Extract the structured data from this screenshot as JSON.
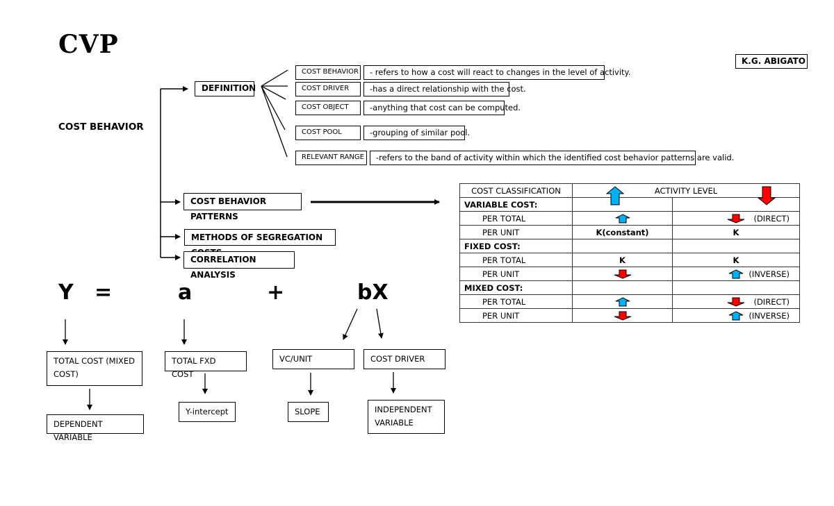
{
  "title": "CVP",
  "author": "K.G. ABIGATO",
  "root": "COST BEHAVIOR",
  "branches": {
    "definition": "DEFINITION",
    "patterns": "COST BEHAVIOR PATTERNS",
    "methods": "METHODS OF SEGREGATION COSTS",
    "correlation": "CORRELATION ANALYSIS"
  },
  "definitions": [
    {
      "term": "COST BEHAVIOR",
      "desc": "- refers to how a cost will react to changes in the level of activity."
    },
    {
      "term": "COST DRIVER",
      "desc": "-has a direct relationship with the cost."
    },
    {
      "term": "COST OBJECT",
      "desc": "-anything that cost can be computed."
    },
    {
      "term": "COST POOL",
      "desc": "-grouping of similar pool."
    },
    {
      "term": "RELEVANT RANGE",
      "desc": "-refers to the band of activity within which the identified cost behavior patterns are valid."
    }
  ],
  "equation": {
    "y": "Y",
    "eq": "=",
    "a": "a",
    "plus": "+",
    "bx": "bX"
  },
  "equation_labels": {
    "y_box": "TOTAL COST (MIXED COST)",
    "y_result": "DEPENDENT VARIABLE",
    "a_box": "TOTAL FXD COST",
    "a_result": "Y-intercept",
    "b_box": "VC/UNIT",
    "b_result": "SLOPE",
    "x_box": "COST DRIVER",
    "x_result": "INDEPENDENT VARIABLE"
  },
  "table": {
    "header": {
      "col1": "COST CLASSIFICATION",
      "col2": "ACTIVITY LEVEL",
      "up_icon": "up-arrow-icon",
      "down_icon": "down-arrow-icon"
    },
    "colors": {
      "up": "#00b0f0",
      "down": "#ff0000"
    },
    "rows": [
      {
        "type": "group",
        "label": "VARIABLE COST:"
      },
      {
        "type": "item",
        "label": "PER TOTAL",
        "increase": "up",
        "decrease": "down",
        "note": "(DIRECT)"
      },
      {
        "type": "item",
        "label": "PER UNIT",
        "increase": "K(constant)",
        "decrease": "K",
        "note": ""
      },
      {
        "type": "group",
        "label": "FIXED COST:"
      },
      {
        "type": "item",
        "label": "PER TOTAL",
        "increase": "K",
        "decrease": "K",
        "note": ""
      },
      {
        "type": "item",
        "label": "PER UNIT",
        "increase": "down",
        "decrease": "up",
        "note": "(INVERSE)"
      },
      {
        "type": "group",
        "label": "MIXED COST:"
      },
      {
        "type": "item",
        "label": "PER TOTAL",
        "increase": "up",
        "decrease": "down",
        "note": "(DIRECT)"
      },
      {
        "type": "item",
        "label": "PER UNIT",
        "increase": "down",
        "decrease": "up",
        "note": "(INVERSE)"
      }
    ]
  }
}
